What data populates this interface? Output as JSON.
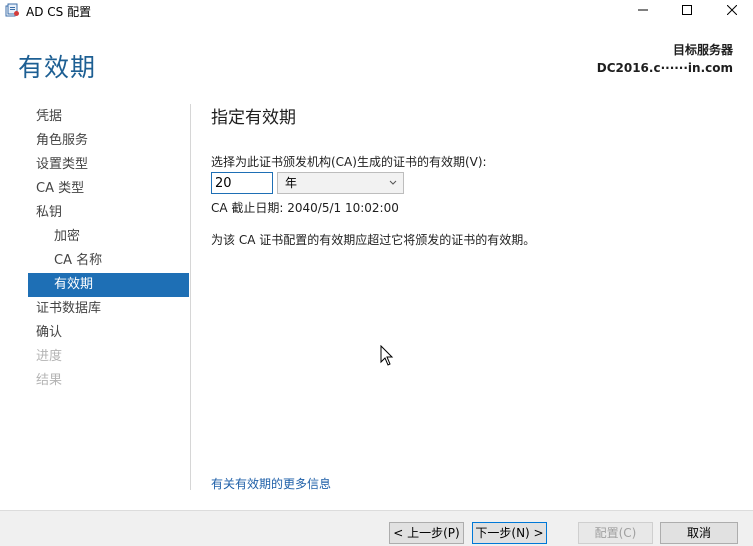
{
  "window": {
    "title": "AD CS 配置",
    "icon": "certificate-server-icon",
    "controls": [
      "minimize-icon",
      "maximize-icon",
      "close-icon"
    ]
  },
  "header": {
    "page_title": "有效期",
    "target_label": "目标服务器",
    "target_server": "DC2016.c······in.com"
  },
  "nav": {
    "items": [
      {
        "label": "凭据",
        "state": "normal",
        "level": 0
      },
      {
        "label": "角色服务",
        "state": "normal",
        "level": 0
      },
      {
        "label": "设置类型",
        "state": "normal",
        "level": 0
      },
      {
        "label": "CA 类型",
        "state": "normal",
        "level": 0
      },
      {
        "label": "私钥",
        "state": "normal",
        "level": 0
      },
      {
        "label": "加密",
        "state": "normal",
        "level": 1
      },
      {
        "label": "CA 名称",
        "state": "normal",
        "level": 1
      },
      {
        "label": "有效期",
        "state": "active",
        "level": 1
      },
      {
        "label": "证书数据库",
        "state": "normal",
        "level": 0
      },
      {
        "label": "确认",
        "state": "normal",
        "level": 0
      },
      {
        "label": "进度",
        "state": "disabled",
        "level": 0
      },
      {
        "label": "结果",
        "state": "disabled",
        "level": 0
      }
    ]
  },
  "main": {
    "section_title": "指定有效期",
    "prompt": "选择为此证书颁发机构(CA)生成的证书的有效期(V):",
    "period_value": "20",
    "unit_selected": "年",
    "expiry_text": "CA 截止日期: 2040/5/1 10:02:00",
    "note": "为该 CA 证书配置的有效期应超过它将颁发的证书的有效期。",
    "more_info_link": "有关有效期的更多信息"
  },
  "footer": {
    "prev_label": "< 上一步(P)",
    "next_label": "下一步(N) >",
    "config_label": "配置(C)",
    "cancel_label": "取消"
  },
  "colors": {
    "accent": "#1e6fb5",
    "heading": "#1d5f93",
    "link": "#1e5fa8",
    "disabled_text": "#b4b4b4"
  }
}
